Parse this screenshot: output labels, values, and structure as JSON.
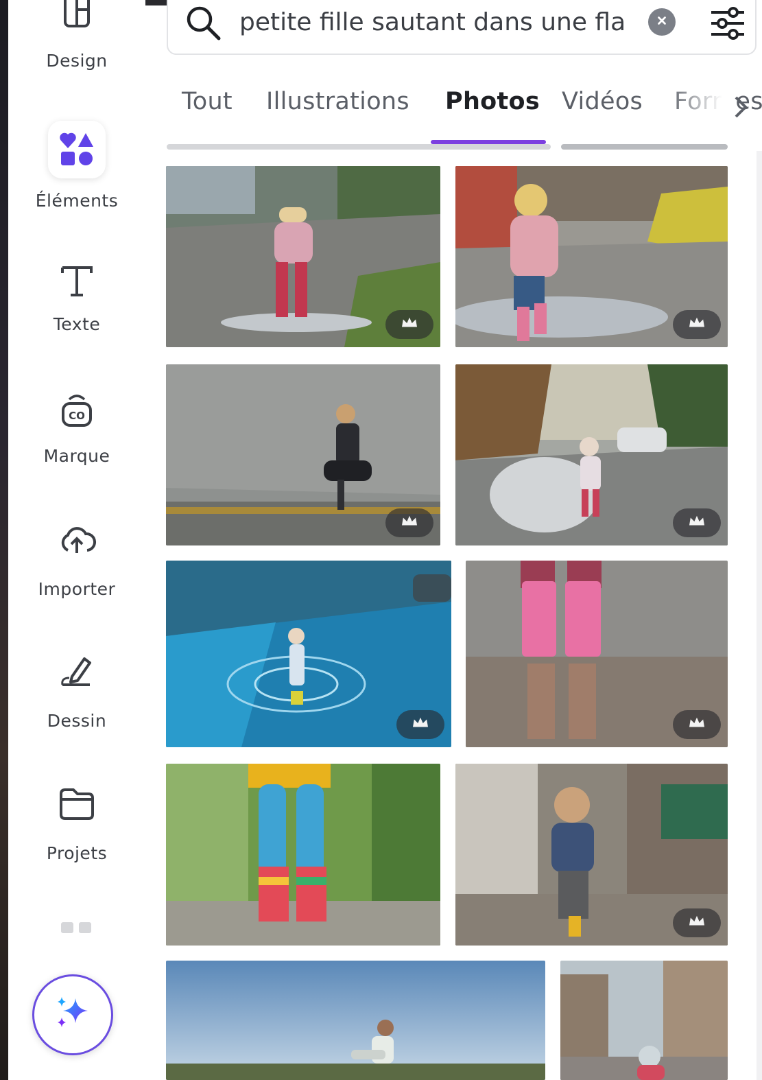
{
  "search": {
    "value": "petite fille sautant dans une flaque",
    "placeholder": ""
  },
  "sidebar": {
    "items": [
      {
        "label": "Design",
        "icon": "design-icon"
      },
      {
        "label": "Éléments",
        "icon": "elements-icon"
      },
      {
        "label": "Texte",
        "icon": "text-icon"
      },
      {
        "label": "Marque",
        "icon": "brand-icon"
      },
      {
        "label": "Importer",
        "icon": "upload-icon"
      },
      {
        "label": "Dessin",
        "icon": "draw-icon"
      },
      {
        "label": "Projets",
        "icon": "folder-icon"
      }
    ],
    "magic_icon": "sparkles-icon",
    "accent": "#6a4de0"
  },
  "tabs": [
    {
      "label": "Tout",
      "active": false
    },
    {
      "label": "Illustrations",
      "active": false
    },
    {
      "label": "Photos",
      "active": true
    },
    {
      "label": "Vidéos",
      "active": false
    },
    {
      "label": "Formes",
      "active": false
    }
  ],
  "colors": {
    "tab_underline": "#7c3fe0",
    "badge_bg": "#3a3a3f"
  },
  "photos": [
    {
      "name": "photo-1",
      "premium": true
    },
    {
      "name": "photo-2",
      "premium": true
    },
    {
      "name": "photo-3",
      "premium": true
    },
    {
      "name": "photo-4",
      "premium": true
    },
    {
      "name": "photo-5",
      "premium": true
    },
    {
      "name": "photo-6",
      "premium": true
    },
    {
      "name": "photo-7",
      "premium": false
    },
    {
      "name": "photo-8",
      "premium": true
    },
    {
      "name": "photo-9",
      "premium": false
    },
    {
      "name": "photo-10",
      "premium": false
    }
  ]
}
